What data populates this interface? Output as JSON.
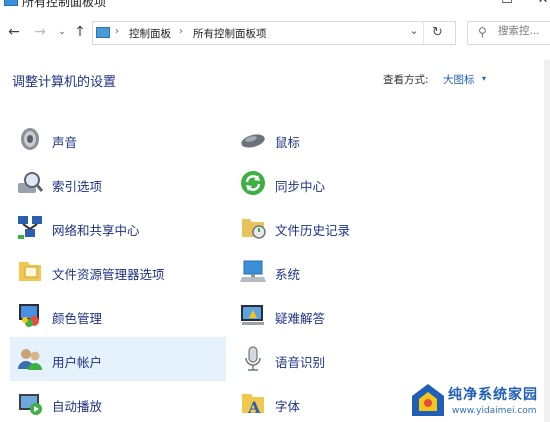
{
  "window": {
    "title": "所有控制面板项",
    "minimize": "—",
    "maximize": "☐",
    "close": "✕"
  },
  "nav": {
    "back": "←",
    "forward": "→",
    "recent": "⌄",
    "up": "↑",
    "refresh": "↻",
    "dropdown": "⌄"
  },
  "address": {
    "crumb_sep": "›",
    "crumbs": [
      "控制面板",
      "所有控制面板项"
    ]
  },
  "search": {
    "placeholder": "搜索控..."
  },
  "header": {
    "title": "调整计算机的设置",
    "viewby_label": "查看方式:",
    "viewby_value": "大图标",
    "viewby_caret": "▾"
  },
  "items": [
    {
      "label": "声音",
      "icon": "speaker-icon"
    },
    {
      "label": "鼠标",
      "icon": "mouse-icon"
    },
    {
      "label": "索引选项",
      "icon": "index-search-icon"
    },
    {
      "label": "同步中心",
      "icon": "sync-center-icon"
    },
    {
      "label": "网络和共享中心",
      "icon": "network-icon"
    },
    {
      "label": "文件历史记录",
      "icon": "file-history-icon"
    },
    {
      "label": "文件资源管理器选项",
      "icon": "explorer-options-icon"
    },
    {
      "label": "系统",
      "icon": "system-icon"
    },
    {
      "label": "颜色管理",
      "icon": "color-management-icon"
    },
    {
      "label": "疑难解答",
      "icon": "troubleshoot-icon"
    },
    {
      "label": "用户帐户",
      "icon": "user-accounts-icon",
      "selected": true
    },
    {
      "label": "语音识别",
      "icon": "microphone-icon"
    },
    {
      "label": "自动播放",
      "icon": "autoplay-icon"
    },
    {
      "label": "字体",
      "icon": "fonts-icon"
    }
  ],
  "watermark": {
    "line1": "纯净系统家园",
    "line2": "www.yidaimei.com"
  },
  "colors": {
    "link": "#1e3287",
    "accent": "#1e5fb4",
    "selected_bg": "#e5f1fb"
  }
}
